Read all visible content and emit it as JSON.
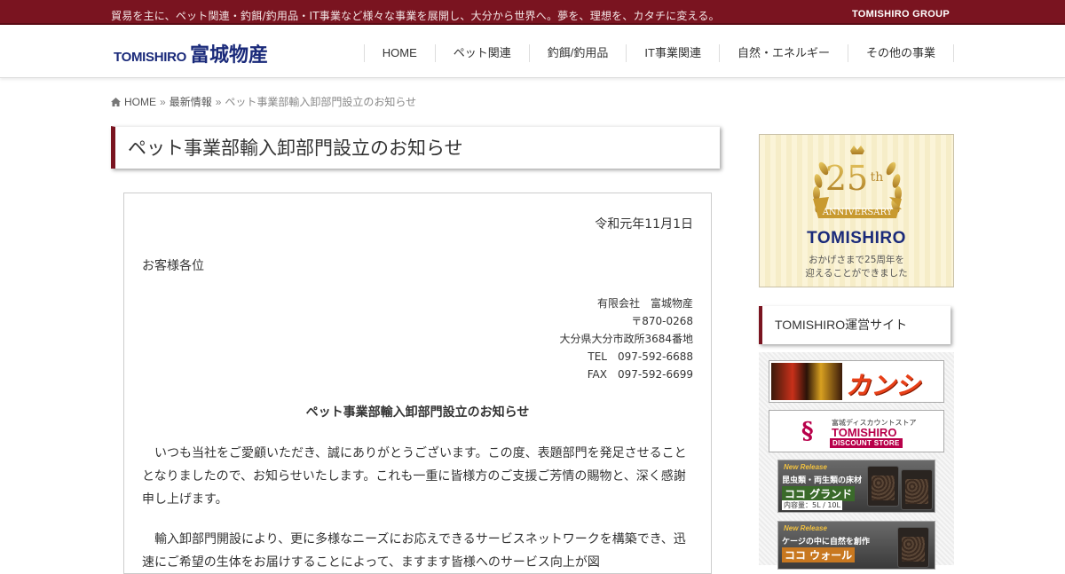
{
  "topbar": {
    "tagline": "貿易を主に、ペット関連・釣餌/釣用品・IT事業など様々な事業を展開し、大分から世界へ。夢を、理想を、カタチに変える。",
    "group": "TOMISHIRO GROUP"
  },
  "header": {
    "logo_en": "TOMISHIRO",
    "logo_jp": "富城物産",
    "nav": [
      "HOME",
      "ペット関連",
      "釣餌/釣用品",
      "IT事業関連",
      "自然・エネルギー",
      "その他の事業"
    ]
  },
  "breadcrumb": {
    "home": "HOME",
    "sep": "»",
    "section": "最新情報",
    "current": "ペット事業部輸入卸部門設立のお知らせ"
  },
  "article": {
    "title": "ペット事業部輸入卸部門設立のお知らせ",
    "date": "令和元年11月1日",
    "salutation": "お客様各位",
    "sender": {
      "company": "有限会社　富城物産",
      "postal": "〒870-0268",
      "address": "大分県大分市政所3684番地",
      "tel": "TEL　097-592-6688",
      "fax": "FAX　097-592-6699"
    },
    "notice_title": "ペット事業部輸入卸部門設立のお知らせ",
    "para1": "　いつも当社をご愛顧いただき、誠にありがとうございます。この度、表題部門を発足させることとなりましたので、お知らせいたします。これも一重に皆様方のご支援ご芳情の賜物と、深く感謝申し上げます。",
    "para2": "　輸入卸部門開設により、更に多様なニーズにお応えできるサービスネットワークを構築でき、迅速にご希望の生体をお届けすることによって、ますます皆様へのサービス向上が図"
  },
  "sidebar": {
    "anniversary": {
      "number": "25",
      "suffix": "th",
      "ribbon": "ANNIVERSARY",
      "brand": "TOMISHIRO",
      "msg_line1": "おかげさまで25周年を",
      "msg_line2": "迎えることができました"
    },
    "sites_title": "TOMISHIRO運営サイト",
    "banners": {
      "kanshiya": "カンシヤ",
      "ds_small": "富城ディスカウントストア",
      "ds_brand": "TOMISHIRO",
      "ds_sub": "DISCOUNT STORE",
      "coco1_nr": "New Release",
      "coco1_sub": "昆虫類・両生類の床材",
      "coco1_name": "ココ グランド",
      "coco1_cap": "内容量：5L / 10L",
      "coco2_nr": "New Release",
      "coco2_sub": "ケージの中に自然を創作",
      "coco2_name": "ココ ウォール"
    }
  },
  "colors": {
    "brand_red": "#7a1420",
    "logo_blue": "#1a2a7a",
    "gold": "#c8a040"
  }
}
